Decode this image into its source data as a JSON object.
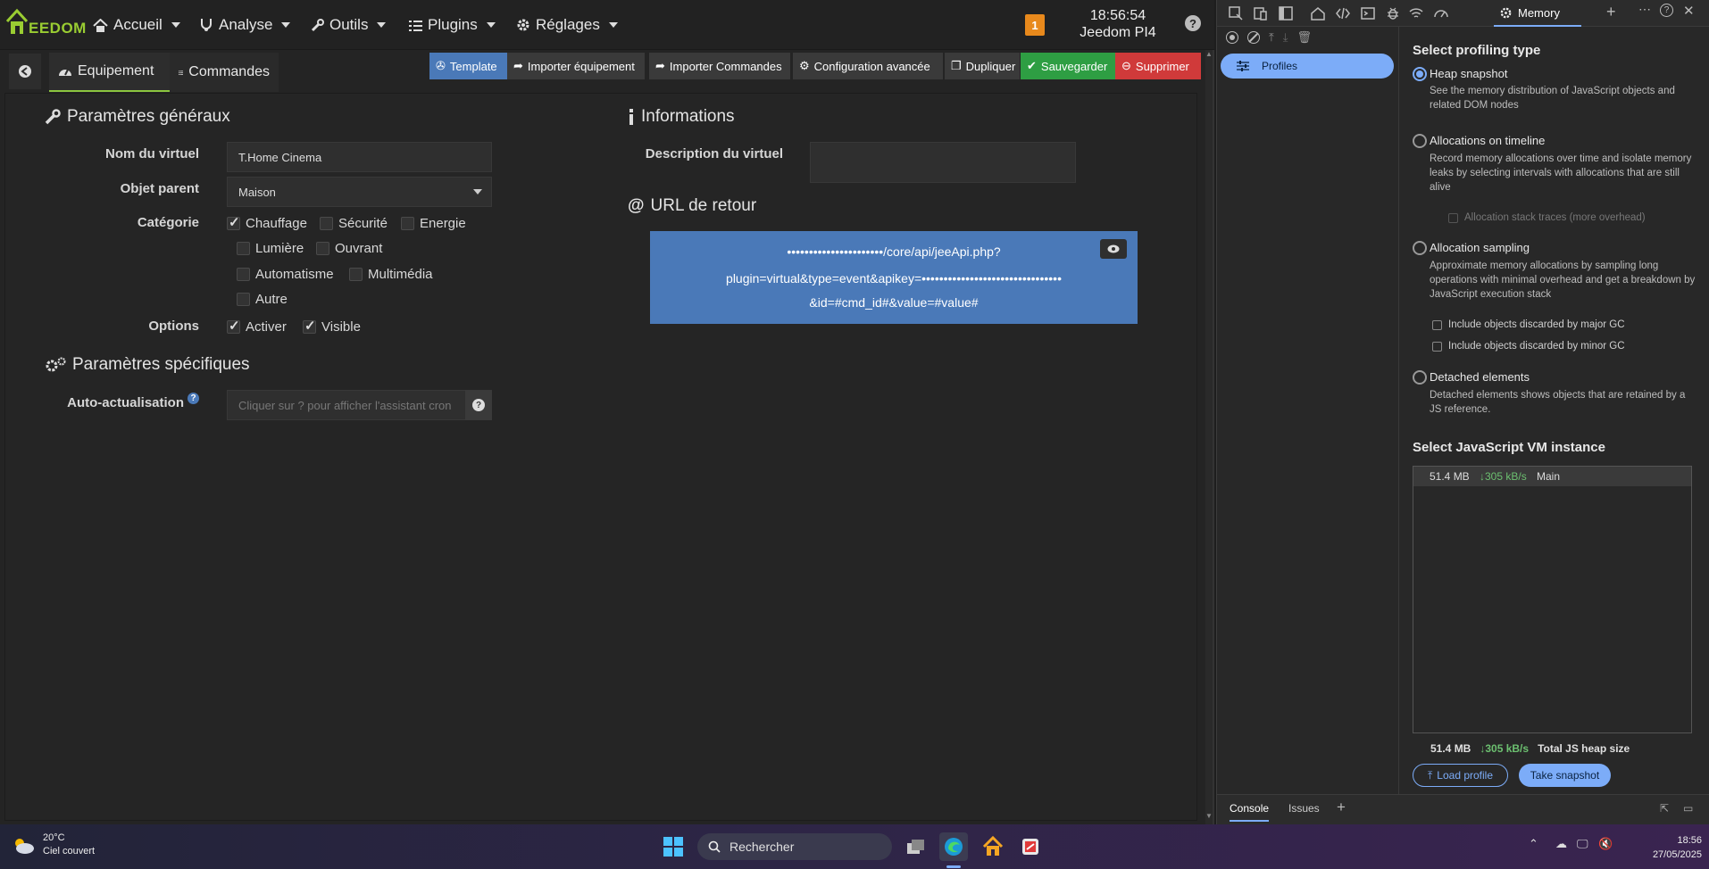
{
  "nav": {
    "logo_text": "EEDOM",
    "items": [
      {
        "label": "Accueil",
        "icon": "home-icon"
      },
      {
        "label": "Analyse",
        "icon": "stethoscope-icon"
      },
      {
        "label": "Outils",
        "icon": "wrench-icon"
      },
      {
        "label": "Plugins",
        "icon": "list-icon"
      },
      {
        "label": "Réglages",
        "icon": "gear-icon"
      }
    ],
    "notification_count": "1",
    "time": "18:56:54",
    "host": "Jeedom PI4",
    "help": "?"
  },
  "tabs": {
    "equipment": "Equipement",
    "commands": "Commandes"
  },
  "toolbar": {
    "template": "Template",
    "import_equipment": "Importer équipement",
    "import_commands": "Importer Commandes",
    "advanced_config": "Configuration avancée",
    "duplicate": "Dupliquer",
    "save": "Sauvegarder",
    "delete": "Supprimer",
    "colors": {
      "template": "#4a79b8",
      "neutral": "#3a3a3a",
      "save": "#2e9e43",
      "delete": "#d03a3a"
    }
  },
  "general": {
    "title": "Paramètres généraux",
    "name_label": "Nom du virtuel",
    "name_value": "T.Home Cinema",
    "parent_label": "Objet parent",
    "parent_value": "Maison",
    "category_label": "Catégorie",
    "categories": [
      {
        "label": "Chauffage",
        "checked": true
      },
      {
        "label": "Sécurité",
        "checked": false
      },
      {
        "label": "Energie",
        "checked": false
      },
      {
        "label": "Lumière",
        "checked": false
      },
      {
        "label": "Ouvrant",
        "checked": false
      },
      {
        "label": "Automatisme",
        "checked": false
      },
      {
        "label": "Multimédia",
        "checked": false
      },
      {
        "label": "Autre",
        "checked": false
      }
    ],
    "options_label": "Options",
    "options": [
      {
        "label": "Activer",
        "checked": true
      },
      {
        "label": "Visible",
        "checked": true
      }
    ]
  },
  "specific": {
    "title": "Paramètres spécifiques",
    "auto_label": "Auto-actualisation",
    "auto_placeholder": "Cliquer sur ? pour afficher l'assistant cron"
  },
  "info": {
    "title": "Informations",
    "desc_label": "Description du virtuel",
    "desc_value": ""
  },
  "url": {
    "title": "URL de retour",
    "line1": "••••••••••••••••••••••/core/api/jeeApi.php?",
    "line2": "plugin=virtual&type=event&apikey=••••••••••••••••••••••••••••••••",
    "line3": "&id=#cmd_id#&value=#value#"
  },
  "devtools": {
    "active_tab": "Memory",
    "sidebar_item": "Profiles",
    "select_type_title": "Select profiling type",
    "options": [
      {
        "title": "Heap snapshot",
        "desc": "See the memory distribution of JavaScript objects and related DOM nodes",
        "selected": true
      },
      {
        "title": "Allocations on timeline",
        "desc": "Record memory allocations over time and isolate memory leaks by selecting intervals with allocations that are still alive",
        "selected": false
      },
      {
        "title": "Allocation sampling",
        "desc": "Approximate memory allocations by sampling long operations with minimal overhead and get a breakdown by JavaScript execution stack",
        "selected": false
      },
      {
        "title": "Detached elements",
        "desc": "Detached elements shows objects that are retained by a JS reference.",
        "selected": false
      }
    ],
    "stack_traces": "Allocation stack traces (more overhead)",
    "major_gc": "Include objects discarded by major GC",
    "minor_gc": "Include objects discarded by minor GC",
    "vm_title": "Select JavaScript VM instance",
    "vm_row": {
      "size": "51.4 MB",
      "rate": "↓305 kB/s",
      "name": "Main"
    },
    "summary": {
      "size": "51.4 MB",
      "rate": "↓305 kB/s",
      "label": "Total JS heap size"
    },
    "load_profile": "Load profile",
    "take_snapshot": "Take snapshot",
    "drawer_tabs": [
      "Console",
      "Issues"
    ]
  },
  "taskbar": {
    "temp": "20°C",
    "weather": "Ciel couvert",
    "search": "Rechercher",
    "time": "18:56",
    "date": "27/05/2025"
  }
}
